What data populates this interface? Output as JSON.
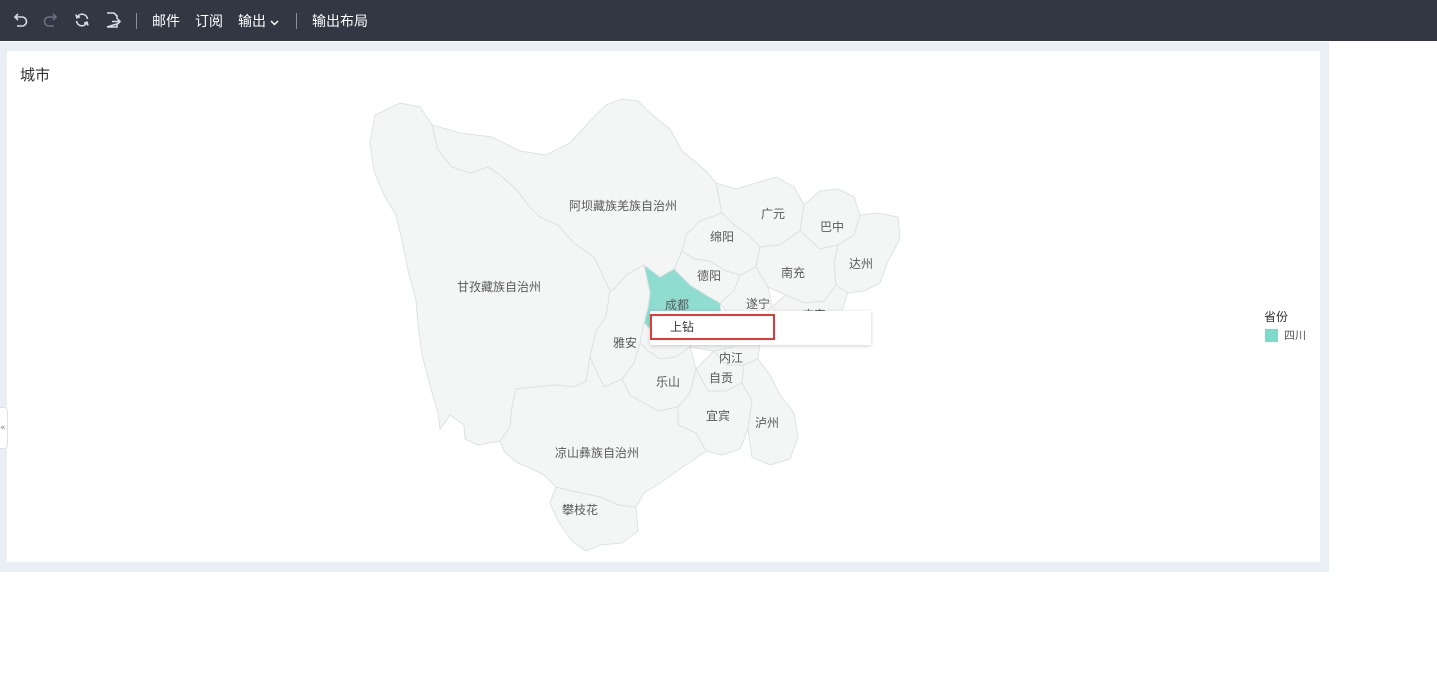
{
  "toolbar": {
    "undo_icon": "undo-icon",
    "redo_icon": "redo-icon",
    "refresh_icon": "refresh-icon",
    "export_icon": "export-icon",
    "mail_label": "邮件",
    "subscribe_label": "订阅",
    "output_label": "输出",
    "output_layout_label": "输出布局"
  },
  "widget": {
    "title": "城市"
  },
  "map": {
    "cities": [
      {
        "name": "阿坝藏族羌族自治州"
      },
      {
        "name": "广元"
      },
      {
        "name": "巴中"
      },
      {
        "name": "绵阳"
      },
      {
        "name": "达州"
      },
      {
        "name": "德阳"
      },
      {
        "name": "南充"
      },
      {
        "name": "甘孜藏族自治州"
      },
      {
        "name": "成都"
      },
      {
        "name": "遂宁"
      },
      {
        "name": "广安"
      },
      {
        "name": "雅安"
      },
      {
        "name": "内江"
      },
      {
        "name": "乐山"
      },
      {
        "name": "自贡"
      },
      {
        "name": "宜宾"
      },
      {
        "name": "泸州"
      },
      {
        "name": "凉山彝族自治州"
      },
      {
        "name": "攀枝花"
      }
    ],
    "selected_city": "成都"
  },
  "context_menu": {
    "drill_up_label": "上钻"
  },
  "legend": {
    "title": "省份",
    "items": [
      {
        "label": "四川",
        "color": "#7ed8cb"
      }
    ]
  },
  "side_tab": {
    "label": "«"
  },
  "colors": {
    "toolbar_bg": "#323744",
    "selected_region": "#8fdcd0",
    "region_fill": "#f4f6f5",
    "highlight_border": "#e53935"
  }
}
